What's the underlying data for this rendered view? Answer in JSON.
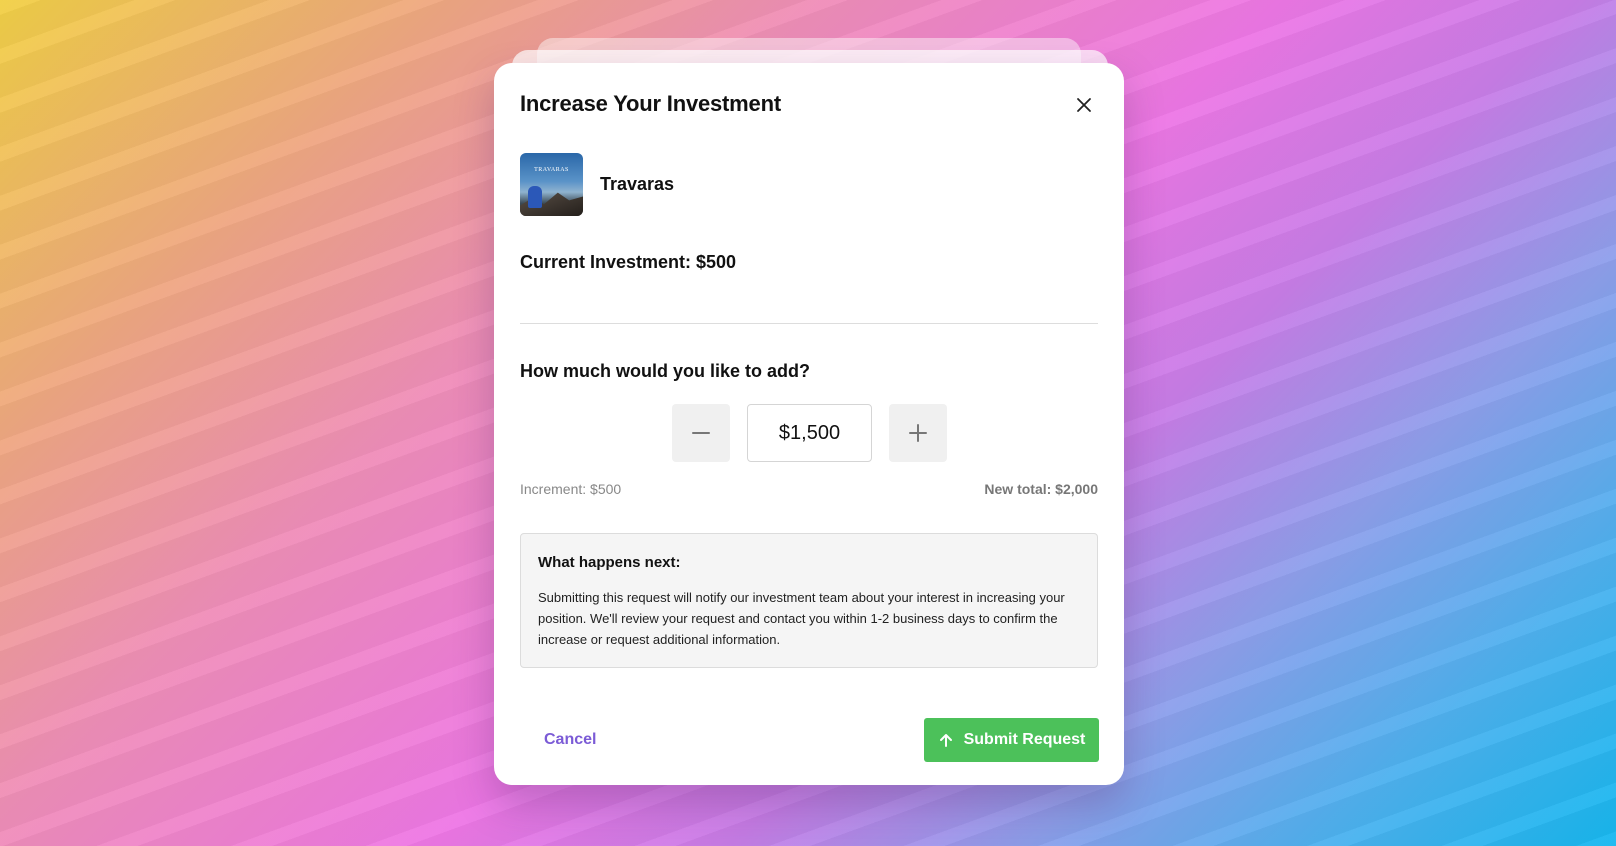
{
  "modal": {
    "title": "Increase Your Investment",
    "close_icon": "close-icon"
  },
  "project": {
    "name": "Travaras",
    "thumbnail_caption": "TRAVARAS"
  },
  "current_investment": "Current Investment: $500",
  "amount": {
    "question": "How much would you like to add?",
    "value": "$1,500",
    "decrement_icon": "minus-icon",
    "increment_icon": "plus-icon",
    "increment_text": "Increment: $500",
    "new_total_text": "New total: $2,000"
  },
  "info": {
    "title": "What happens next:",
    "body": "Submitting this request will notify our investment team about your interest in increasing your position. We'll review your request and contact you within 1-2 business days to confirm the increase or request additional information."
  },
  "actions": {
    "cancel_label": "Cancel",
    "submit_label": "Submit Request",
    "submit_icon": "arrow-up-icon"
  },
  "colors": {
    "accent_purple": "#7b5bd6",
    "submit_green": "#4cc15a"
  }
}
